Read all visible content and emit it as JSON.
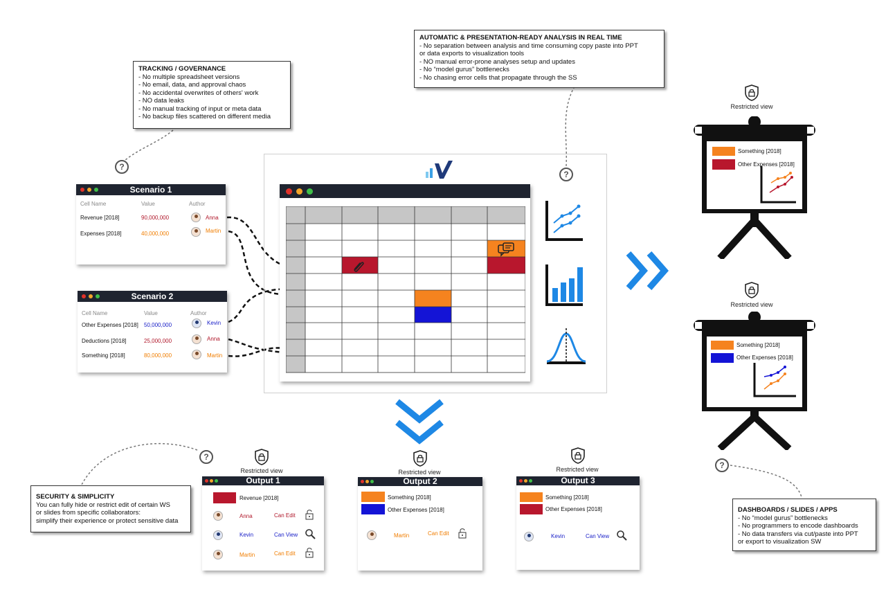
{
  "notes": {
    "tracking": {
      "title": "TRACKING / GOVERNANCE",
      "lines": [
        "- No multiple spreadsheet versions",
        "- No email, data, and approval chaos",
        "- No accidental overwrites of others' work",
        "- NO data leaks",
        "- No manual tracking of input or meta data",
        "- No  backup files scattered on different media"
      ]
    },
    "automatic": {
      "title": "AUTOMATIC & PRESENTATION-READY ANALYSIS IN REAL TIME",
      "lines": [
        "- No separation between analysis and time consuming copy paste into PPT",
        "or data exports to visualization tools",
        "- NO manual error-prone analyses setup and updates",
        "- No “model gurus” bottlenecks",
        "- No chasing error cells that propagate through the SS"
      ]
    },
    "security": {
      "title": "SECURITY & SIMPLICITY",
      "lines": [
        "You can fully hide or restrict edit of certain WS",
        "or slides  from specific collaborators:",
        "simplify their experience or protect sensitive data"
      ]
    },
    "dashboards": {
      "title": "DASHBOARDS / SLIDES / APPS",
      "lines": [
        "- No “model gurus” bottlenecks",
        "- No programmers to encode dashboards",
        "- No data transfers via cut/paste into PPT",
        "or export to visualization SW"
      ]
    }
  },
  "question_mark": "?",
  "restricted_view": "Restricted view",
  "scenario1": {
    "title": "Scenario 1",
    "headers": [
      "Cell Name",
      "Value",
      "Author"
    ],
    "rows": [
      {
        "name": "Revenue [2018]",
        "value": "90,000,000",
        "author": "Anna"
      },
      {
        "name": "Expenses [2018]",
        "value": "40,000,000",
        "author": "Martin"
      }
    ]
  },
  "scenario2": {
    "title": "Scenario 2",
    "headers": [
      "Cell Name",
      "Value",
      "Author"
    ],
    "rows": [
      {
        "name": "Other Expenses [2018]",
        "value": "50,000,000",
        "author": "Kevin"
      },
      {
        "name": "Deductions [2018]",
        "value": "25,000,000",
        "author": "Anna"
      },
      {
        "name": "Something [2018]",
        "value": "80,000,000",
        "author": "Martin"
      }
    ]
  },
  "outputs": {
    "output1": {
      "title": "Output 1",
      "legend": [
        "Revenue [2018]"
      ],
      "users": [
        {
          "name": "Anna",
          "perm": "Can Edit"
        },
        {
          "name": "Kevin",
          "perm": "Can View"
        },
        {
          "name": "Martin",
          "perm": "Can Edit"
        }
      ]
    },
    "output2": {
      "title": "Output 2",
      "legend": [
        "Something [2018]",
        "Other Expenses [2018]"
      ],
      "users": [
        {
          "name": "Martin",
          "perm": "Can Edit"
        }
      ]
    },
    "output3": {
      "title": "Output 3",
      "legend": [
        "Something [2018]",
        "Other Expenses [2018]"
      ],
      "users": [
        {
          "name": "Kevin",
          "perm": "Can View"
        }
      ]
    }
  },
  "boards": {
    "top": {
      "legend": [
        "Something [2018]",
        "Other Expenses [2018]"
      ]
    },
    "bottom": {
      "legend": [
        "Something [2018]",
        "Other Expenses [2018]"
      ]
    }
  },
  "colors": {
    "red": "#b8172d",
    "orange": "#f5831f",
    "blue": "#1414d6",
    "accent": "#1e88e5",
    "dark": "#1f2430"
  }
}
